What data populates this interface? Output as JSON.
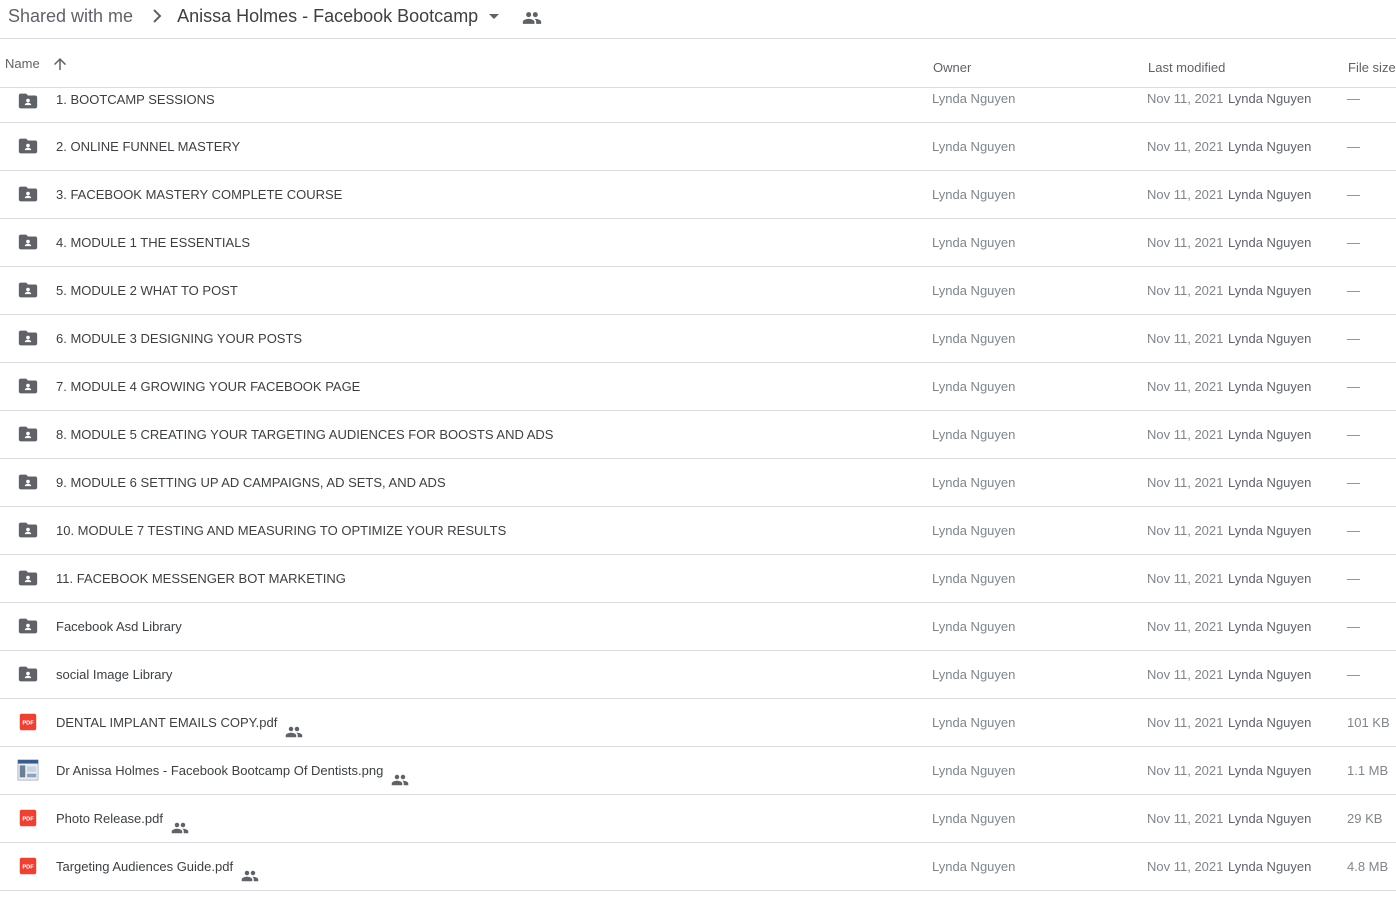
{
  "breadcrumb": {
    "parent": "Shared with me",
    "current": "Anissa Holmes - Facebook Bootcamp"
  },
  "columns": {
    "name": "Name",
    "owner": "Owner",
    "last_modified": "Last modified",
    "file_size": "File size"
  },
  "colors": {
    "folder": "#5f6368",
    "pdf": "#ea4335",
    "divider": "#dadce0"
  },
  "files": [
    {
      "name": "1. BOOTCAMP SESSIONS",
      "type": "folder",
      "shared": false,
      "owner": "Lynda Nguyen",
      "date": "Nov 11, 2021",
      "modified_by": "Lynda Nguyen",
      "size": "—"
    },
    {
      "name": "2. ONLINE FUNNEL MASTERY",
      "type": "folder",
      "shared": false,
      "owner": "Lynda Nguyen",
      "date": "Nov 11, 2021",
      "modified_by": "Lynda Nguyen",
      "size": "—"
    },
    {
      "name": "3. FACEBOOK MASTERY COMPLETE COURSE",
      "type": "folder",
      "shared": false,
      "owner": "Lynda Nguyen",
      "date": "Nov 11, 2021",
      "modified_by": "Lynda Nguyen",
      "size": "—"
    },
    {
      "name": "4. MODULE 1 THE ESSENTIALS",
      "type": "folder",
      "shared": false,
      "owner": "Lynda Nguyen",
      "date": "Nov 11, 2021",
      "modified_by": "Lynda Nguyen",
      "size": "—"
    },
    {
      "name": "5. MODULE 2 WHAT TO POST",
      "type": "folder",
      "shared": false,
      "owner": "Lynda Nguyen",
      "date": "Nov 11, 2021",
      "modified_by": "Lynda Nguyen",
      "size": "—"
    },
    {
      "name": "6. MODULE 3 DESIGNING YOUR POSTS",
      "type": "folder",
      "shared": false,
      "owner": "Lynda Nguyen",
      "date": "Nov 11, 2021",
      "modified_by": "Lynda Nguyen",
      "size": "—"
    },
    {
      "name": "7. MODULE 4 GROWING YOUR FACEBOOK PAGE",
      "type": "folder",
      "shared": false,
      "owner": "Lynda Nguyen",
      "date": "Nov 11, 2021",
      "modified_by": "Lynda Nguyen",
      "size": "—"
    },
    {
      "name": "8. MODULE 5 CREATING YOUR TARGETING AUDIENCES FOR BOOSTS AND ADS",
      "type": "folder",
      "shared": false,
      "owner": "Lynda Nguyen",
      "date": "Nov 11, 2021",
      "modified_by": "Lynda Nguyen",
      "size": "—"
    },
    {
      "name": "9. MODULE 6 SETTING UP AD CAMPAIGNS, AD SETS, AND ADS",
      "type": "folder",
      "shared": false,
      "owner": "Lynda Nguyen",
      "date": "Nov 11, 2021",
      "modified_by": "Lynda Nguyen",
      "size": "—"
    },
    {
      "name": "10. MODULE 7 TESTING AND MEASURING TO OPTIMIZE YOUR RESULTS",
      "type": "folder",
      "shared": false,
      "owner": "Lynda Nguyen",
      "date": "Nov 11, 2021",
      "modified_by": "Lynda Nguyen",
      "size": "—"
    },
    {
      "name": "11. FACEBOOK MESSENGER BOT MARKETING",
      "type": "folder",
      "shared": false,
      "owner": "Lynda Nguyen",
      "date": "Nov 11, 2021",
      "modified_by": "Lynda Nguyen",
      "size": "—"
    },
    {
      "name": "Facebook Asd Library",
      "type": "folder",
      "shared": false,
      "owner": "Lynda Nguyen",
      "date": "Nov 11, 2021",
      "modified_by": "Lynda Nguyen",
      "size": "—"
    },
    {
      "name": "social Image Library",
      "type": "folder",
      "shared": false,
      "owner": "Lynda Nguyen",
      "date": "Nov 11, 2021",
      "modified_by": "Lynda Nguyen",
      "size": "—"
    },
    {
      "name": "DENTAL IMPLANT EMAILS COPY.pdf",
      "type": "pdf",
      "shared": true,
      "owner": "Lynda Nguyen",
      "date": "Nov 11, 2021",
      "modified_by": "Lynda Nguyen",
      "size": "101 KB"
    },
    {
      "name": "Dr Anissa Holmes - Facebook Bootcamp Of Dentists.png",
      "type": "image",
      "shared": true,
      "owner": "Lynda Nguyen",
      "date": "Nov 11, 2021",
      "modified_by": "Lynda Nguyen",
      "size": "1.1 MB"
    },
    {
      "name": "Photo Release.pdf",
      "type": "pdf",
      "shared": true,
      "owner": "Lynda Nguyen",
      "date": "Nov 11, 2021",
      "modified_by": "Lynda Nguyen",
      "size": "29 KB"
    },
    {
      "name": "Targeting Audiences Guide.pdf",
      "type": "pdf",
      "shared": true,
      "owner": "Lynda Nguyen",
      "date": "Nov 11, 2021",
      "modified_by": "Lynda Nguyen",
      "size": "4.8 MB"
    }
  ]
}
